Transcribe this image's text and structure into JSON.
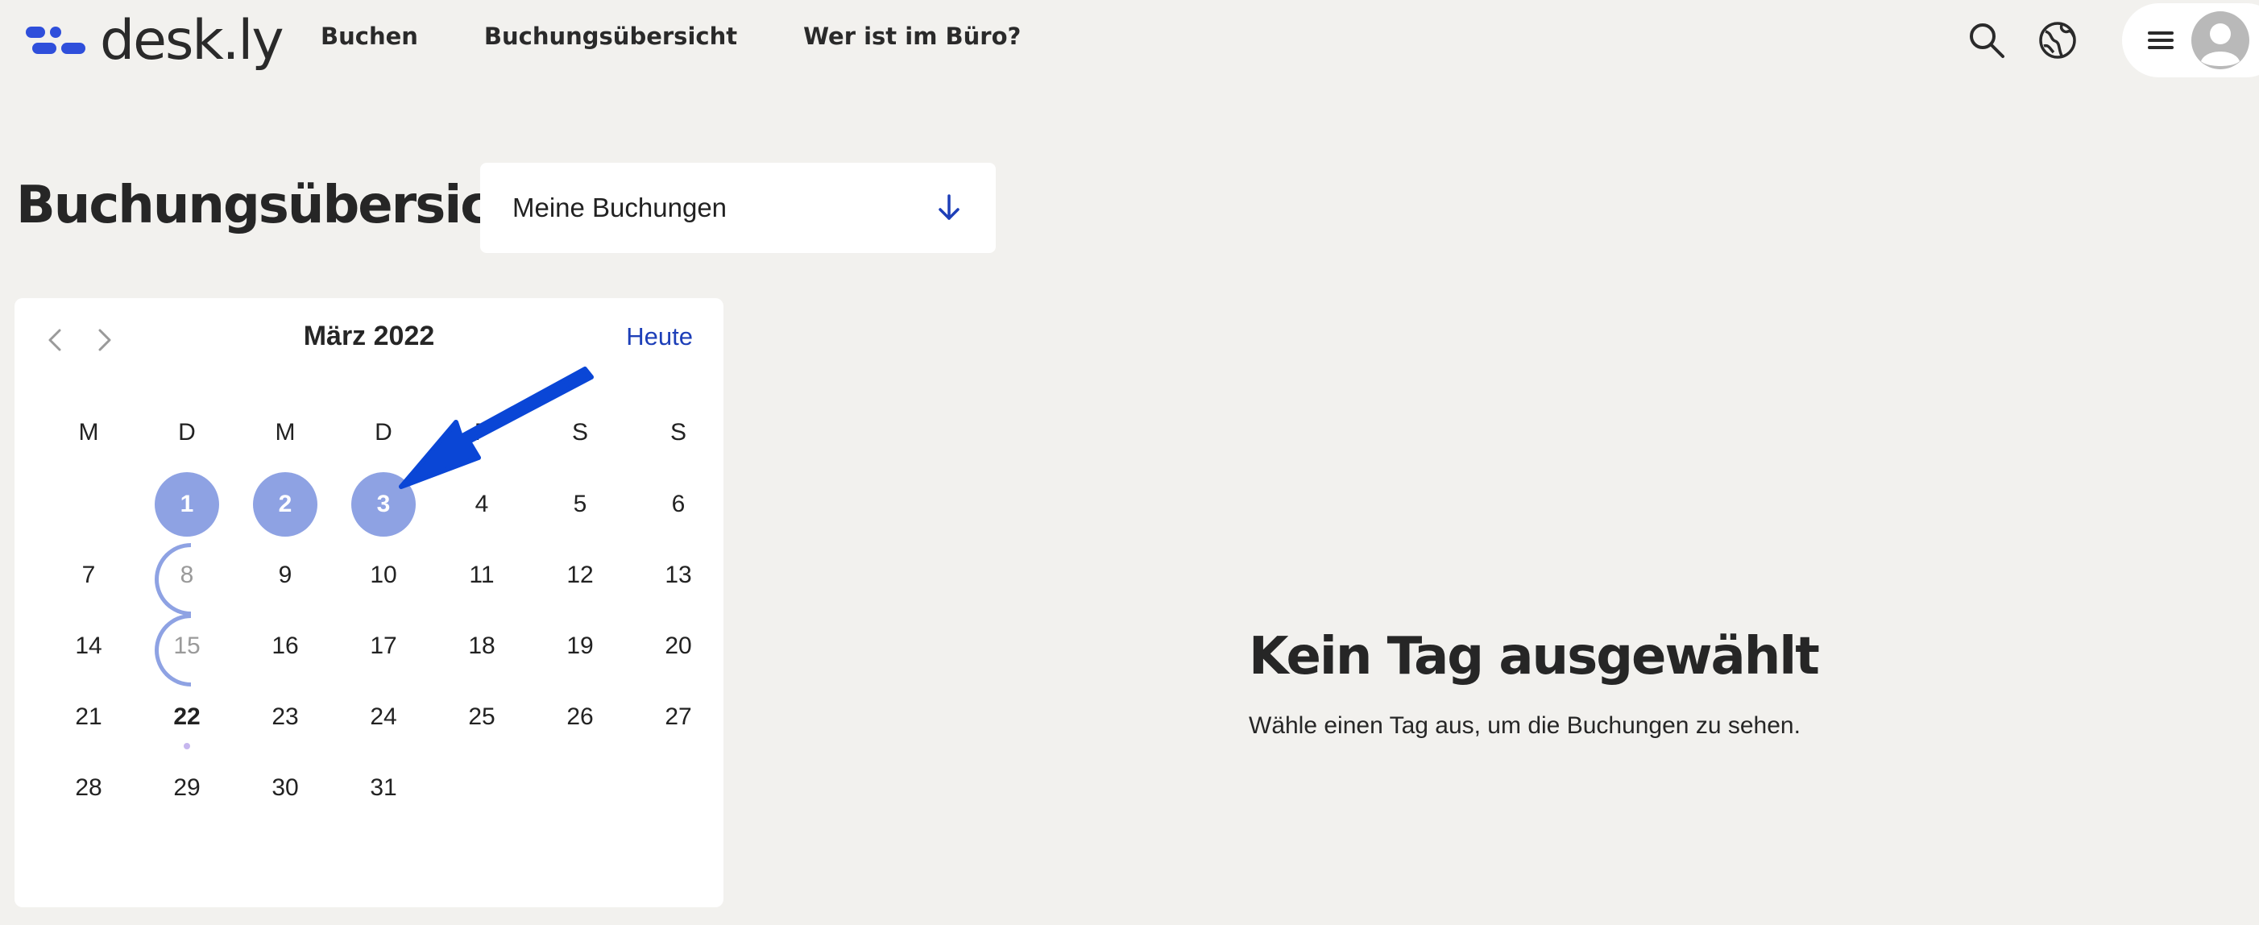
{
  "app": {
    "logo_text": "desk.ly"
  },
  "nav": {
    "items": [
      {
        "label": "Buchen"
      },
      {
        "label": "Buchungsübersicht"
      },
      {
        "label": "Wer ist im Büro?"
      }
    ]
  },
  "header_icons": [
    "search-icon",
    "globe-icon",
    "menu-icon",
    "user-avatar-icon"
  ],
  "page": {
    "title": "Buchungsübersicht",
    "filter_select": {
      "value": "Meine Buchungen"
    }
  },
  "calendar": {
    "month_label": "März 2022",
    "today_label": "Heute",
    "weekdays": [
      "M",
      "D",
      "M",
      "D",
      "F",
      "S",
      "S"
    ],
    "weeks": [
      [
        "",
        "1",
        "2",
        "3",
        "4",
        "5",
        "6"
      ],
      [
        "7",
        "8",
        "9",
        "10",
        "11",
        "12",
        "13"
      ],
      [
        "14",
        "15",
        "16",
        "17",
        "18",
        "19",
        "20"
      ],
      [
        "21",
        "22",
        "23",
        "24",
        "25",
        "26",
        "27"
      ],
      [
        "28",
        "29",
        "30",
        "31",
        "",
        "",
        ""
      ]
    ],
    "booked_days": [
      "1",
      "2",
      "3"
    ],
    "partial_days": [
      "8",
      "15"
    ],
    "today": "22"
  },
  "empty_state": {
    "title": "Kein Tag ausgewählt",
    "subtitle": "Wähle einen Tag aus, um die Buchungen zu sehen."
  },
  "colors": {
    "accent": "#1d3fb8",
    "booked": "#8ea2e3",
    "annotation_arrow": "#0a46d6",
    "background": "#f2f1ee"
  }
}
